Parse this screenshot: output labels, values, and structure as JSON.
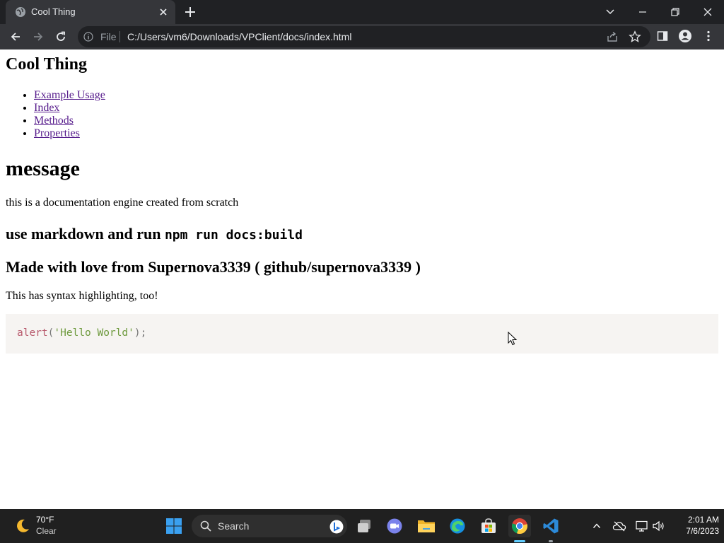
{
  "browser": {
    "tab": {
      "title": "Cool Thing"
    },
    "address": {
      "scheme_label": "File",
      "url": "C:/Users/vm6/Downloads/VPClient/docs/index.html"
    }
  },
  "page": {
    "title": "Cool Thing",
    "nav": [
      "Example Usage",
      "Index",
      "Methods",
      "Properties"
    ],
    "section_heading": "message",
    "intro": "this is a documentation engine created from scratch",
    "h2_prefix": "use markdown and run ",
    "h2_code": "npm run docs:build",
    "credit": "Made with love from Supernova3339 ( github/supernova3339 )",
    "syntax_note": "This has syntax highlighting, too!",
    "code": {
      "fn": "alert",
      "open": "(",
      "str": "'Hello World'",
      "close": ");"
    }
  },
  "taskbar": {
    "weather": {
      "temp": "70°F",
      "desc": "Clear"
    },
    "search_label": "Search",
    "clock": {
      "time": "2:01 AM",
      "date": "7/6/2023"
    }
  },
  "colors": {
    "chrome_dark": "#202124",
    "chrome_tab": "#35363a",
    "visited_link": "#551a8b",
    "code_bg": "#f6f4f2",
    "taskbar": "#202020",
    "accent": "#60cdff"
  }
}
